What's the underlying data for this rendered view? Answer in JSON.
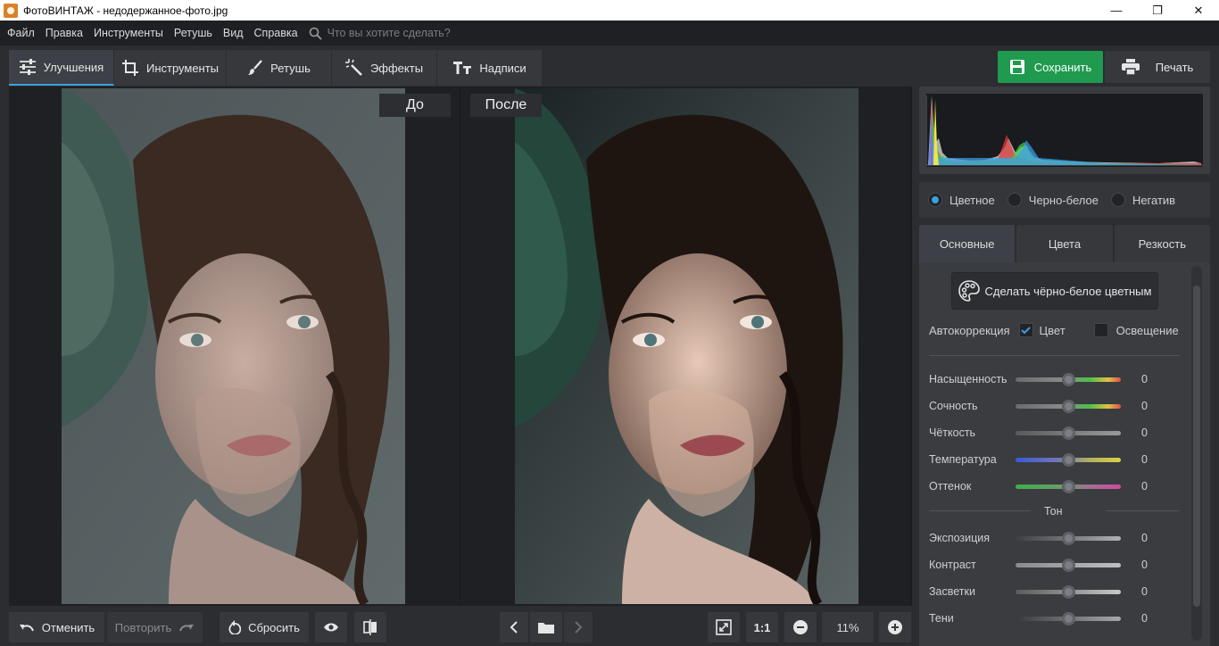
{
  "window": {
    "title": "ФотоВИНТАЖ - недодержанное-фото.jpg",
    "controls": {
      "minimize": "—",
      "maximize": "❐",
      "close": "✕"
    }
  },
  "menu": {
    "items": [
      "Файл",
      "Правка",
      "Инструменты",
      "Ретушь",
      "Вид",
      "Справка"
    ],
    "search_placeholder": "Что вы хотите сделать?"
  },
  "tabs": [
    {
      "label": "Улучшения",
      "icon": "sliders-icon",
      "active": true
    },
    {
      "label": "Инструменты",
      "icon": "crop-icon"
    },
    {
      "label": "Ретушь",
      "icon": "brush-icon"
    },
    {
      "label": "Эффекты",
      "icon": "magic-wand-icon"
    },
    {
      "label": "Надписи",
      "icon": "text-icon"
    }
  ],
  "toolbar": {
    "save_label": "Сохранить",
    "print_label": "Печать"
  },
  "canvas": {
    "before_label": "До",
    "after_label": "После"
  },
  "bottom": {
    "undo_label": "Отменить",
    "redo_label": "Повторить",
    "reset_label": "Сбросить",
    "zoom_ratio_label": "1:1",
    "zoom_value": "11%"
  },
  "colors": {
    "accent": "#3b9fe0",
    "save_green": "#1f9a4f",
    "panel_bg": "#3a3c40",
    "app_bg": "#2b2d30"
  },
  "right_panel": {
    "modes": [
      {
        "label": "Цветное",
        "selected": true
      },
      {
        "label": "Черно-белое",
        "selected": false
      },
      {
        "label": "Негатив",
        "selected": false
      }
    ],
    "subtabs": [
      {
        "label": "Основные",
        "active": true
      },
      {
        "label": "Цвета",
        "active": false
      },
      {
        "label": "Резкость",
        "active": false
      }
    ],
    "bw_button": "Сделать чёрно-белое цветным",
    "autocorrection": {
      "label": "Автокоррекция",
      "color_label": "Цвет",
      "color_checked": true,
      "lighting_label": "Освещение",
      "lighting_checked": false
    },
    "sliders_main": [
      {
        "label": "Насыщенность",
        "value": "0"
      },
      {
        "label": "Сочность",
        "value": "0"
      },
      {
        "label": "Чёткость",
        "value": "0"
      },
      {
        "label": "Температура",
        "value": "0"
      },
      {
        "label": "Оттенок",
        "value": "0"
      }
    ],
    "tone_heading": "Тон",
    "sliders_tone": [
      {
        "label": "Экспозиция",
        "value": "0"
      },
      {
        "label": "Контраст",
        "value": "0"
      },
      {
        "label": "Засветки",
        "value": "0"
      },
      {
        "label": "Тени",
        "value": "0"
      }
    ]
  }
}
